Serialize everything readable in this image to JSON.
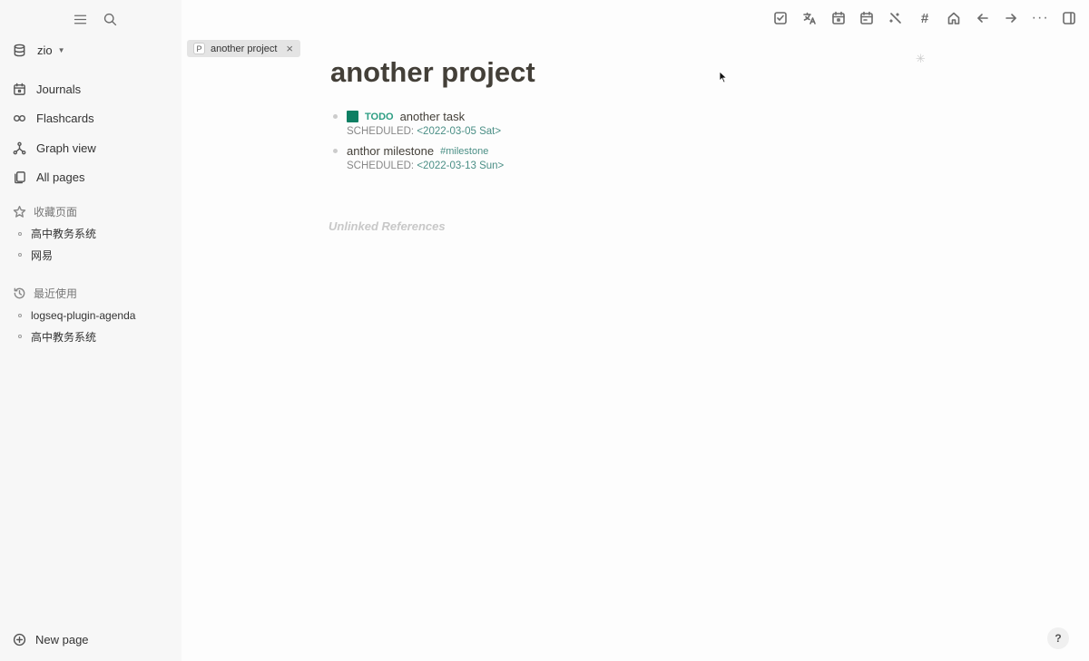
{
  "sidebar": {
    "repo_name": "zio",
    "nav": [
      {
        "label": "Journals",
        "icon": "calendar-icon"
      },
      {
        "label": "Flashcards",
        "icon": "infinity-icon"
      },
      {
        "label": "Graph view",
        "icon": "graph-icon"
      },
      {
        "label": "All pages",
        "icon": "pages-icon"
      }
    ],
    "favorites": {
      "title": "收藏页面",
      "items": [
        "高中教务系统",
        "网易"
      ]
    },
    "recent": {
      "title": "最近使用",
      "items": [
        "logseq-plugin-agenda",
        "高中教务系统"
      ]
    },
    "new_page_label": "New page"
  },
  "tab": {
    "badge": "P",
    "label": "another project",
    "close": "×"
  },
  "toolbar": {
    "hash": "#",
    "more": "···"
  },
  "page": {
    "title": "another project",
    "blocks": [
      {
        "marker": "TODO",
        "text": "another task",
        "scheduled_label": "SCHEDULED:",
        "scheduled_date": "<2022-03-05 Sat>"
      },
      {
        "text": "anthor milestone",
        "tag": "#milestone",
        "scheduled_label": "SCHEDULED:",
        "scheduled_date": "<2022-03-13 Sun>"
      }
    ],
    "unlinked_references": "Unlinked References"
  },
  "help_label": "?",
  "colors": {
    "accent": "#0e7f63",
    "link": "#4b8f86",
    "sidebar_bg": "#f7f7f7"
  }
}
